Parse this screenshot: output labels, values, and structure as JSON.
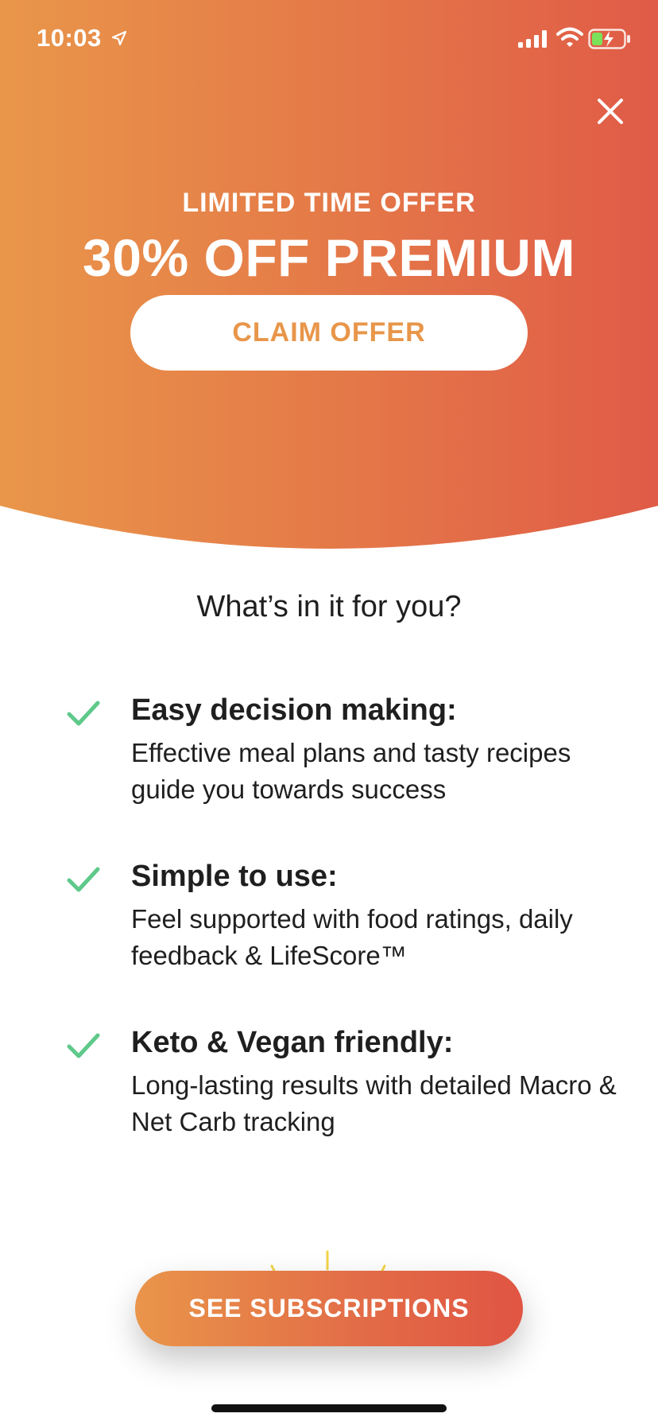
{
  "status_bar": {
    "time": "10:03",
    "icons": [
      "location-arrow-icon",
      "cellular-signal-icon",
      "wifi-icon",
      "battery-charging-icon"
    ]
  },
  "colors": {
    "gradient_start": "#e9964a",
    "gradient_end": "#e05b47",
    "claim_text": "#e8964a",
    "check_green": "#5ec98a",
    "text_dark": "#1f1f1f"
  },
  "hero": {
    "kicker": "LIMITED TIME OFFER",
    "title": "30% OFF PREMIUM",
    "claim_button_label": "CLAIM OFFER",
    "close_icon": "close-icon"
  },
  "benefits": {
    "heading": "What’s in it for you?",
    "items": [
      {
        "title": "Easy decision making:",
        "description": "Effective meal plans and tasty recipes guide you towards success"
      },
      {
        "title": "Simple to use:",
        "description": "Feel supported with food ratings, daily feedback & LifeScore™"
      },
      {
        "title": "Keto & Vegan friendly:",
        "description": "Long-lasting results with detailed Macro & Net Carb tracking"
      }
    ]
  },
  "footer": {
    "cta_label": "SEE SUBSCRIPTIONS"
  }
}
